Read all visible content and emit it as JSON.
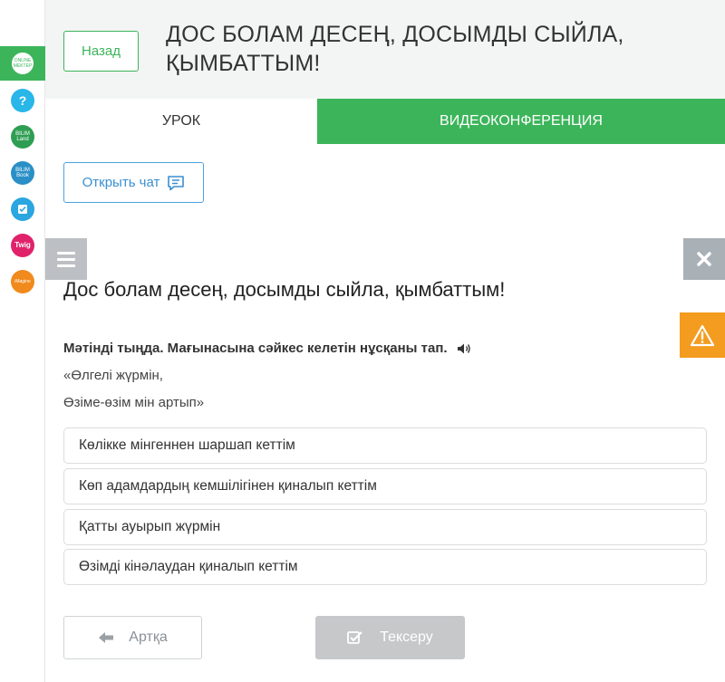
{
  "header": {
    "back_label": "Назад",
    "title_line1": "ДОС БОЛАМ ДЕСЕҢ, ДОСЫМДЫ СЫЙЛА,",
    "title_line2": "ҚЫМБАТТЫМ!"
  },
  "tabs": [
    {
      "label": "УРОК",
      "active": true
    },
    {
      "label": "ВИДЕОКОНФЕРЕНЦИЯ",
      "active": false
    }
  ],
  "chat": {
    "label": "Открыть чат"
  },
  "sidebar": {
    "items": [
      {
        "name": "online-mektep",
        "text": "ONLINE MEKTEP",
        "color": "#3cb55a"
      },
      {
        "name": "help",
        "text": "?",
        "color": "#29b6e8"
      },
      {
        "name": "bilimland",
        "text": "BILIM Land",
        "color": "#2e9e52"
      },
      {
        "name": "bilimbook",
        "text": "BILIM Book",
        "color": "#2a8fc6"
      },
      {
        "name": "test",
        "text": "Test",
        "color": "#2aa6e0"
      },
      {
        "name": "twig",
        "text": "Twig",
        "color": "#e0226b"
      },
      {
        "name": "imagine",
        "text": "iMagine",
        "color": "#f08a1c"
      }
    ]
  },
  "content": {
    "lesson_title": "Дос болам десең, досымды сыйла, қымбаттым!",
    "task": "Мәтінді тыңда. Мағынасына сәйкес келетін нұсқаны тап.",
    "quote_line1": "«Өлгелі жүрмін,",
    "quote_line2": "Өзіме-өзім мін артып»",
    "options": [
      "Көлікке мінгеннен шаршап кеттім",
      "Көп адамдардың кемшілігінен қиналып кеттім",
      "Қатты ауырып жүрмін",
      "Өзімді кінәлаудан қиналып кеттім"
    ]
  },
  "footer": {
    "back_label": "Артқа",
    "check_label": "Тексеру"
  },
  "colors": {
    "brand_green": "#3cb55a",
    "chat_blue": "#4aa3df",
    "warning_orange": "#f39c1f",
    "disabled_gray": "#c6c8ca"
  }
}
